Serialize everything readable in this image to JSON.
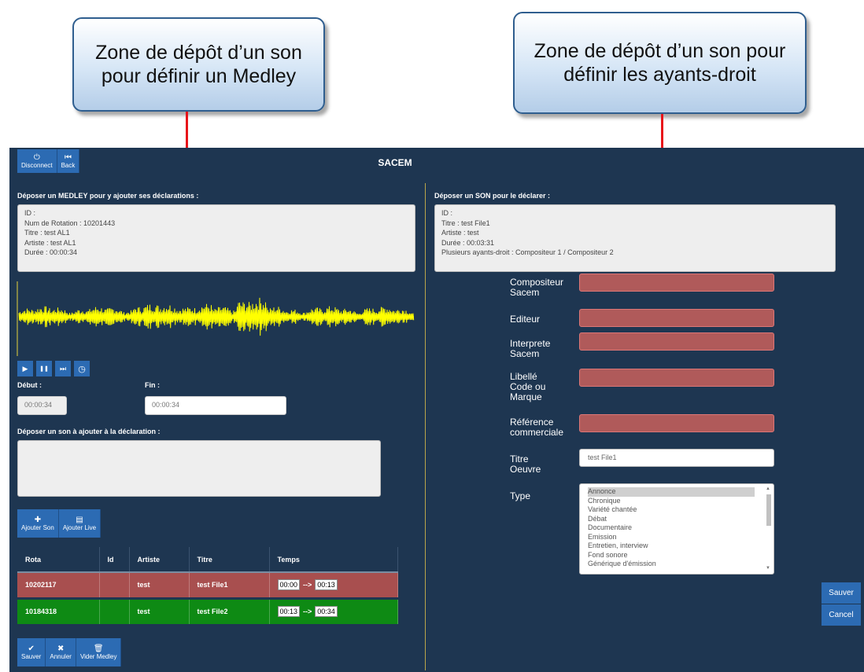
{
  "callouts": {
    "medley": "Zone de dépôt d’un son pour définir un Medley",
    "ayants": "Zone de dépôt d’un son pour définir les ayants-droit"
  },
  "app": {
    "title": "SACEM"
  },
  "toolbar": {
    "disconnect": {
      "icon": "power-icon",
      "glyph": "⏻",
      "label": "Disconnect"
    },
    "back": {
      "icon": "skip-back-icon",
      "glyph": "⏮",
      "label": "Back"
    }
  },
  "medley": {
    "section_label": "Déposer un MEDLEY pour y ajouter ses déclarations :",
    "info": [
      "ID :",
      "Num de Rotation : 10201443",
      "Titre : test AL1",
      "Artiste : test AL1",
      "Durée : 00:00:34"
    ]
  },
  "player": {
    "waveform_color": "#ffff00",
    "controls": [
      {
        "name": "play-icon",
        "glyph": "▶"
      },
      {
        "name": "pause-icon",
        "glyph": "❚❚"
      },
      {
        "name": "step-forward-icon",
        "glyph": "⏭"
      },
      {
        "name": "clock-icon",
        "glyph": "◷"
      }
    ],
    "debut_label": "Début :",
    "debut_value": "00:00:34",
    "fin_label": "Fin :",
    "fin_value": "00:00:34"
  },
  "ajout": {
    "label": "Déposer un son à ajouter à la déclaration :",
    "add_son": {
      "icon": "plus-icon",
      "glyph": "✚",
      "label": "Ajouter Son"
    },
    "add_live": {
      "icon": "list-icon",
      "glyph": "▤",
      "label": "Ajouter Live"
    }
  },
  "table": {
    "headers": [
      "Rota",
      "Id",
      "Artiste",
      "Titre",
      "Temps"
    ],
    "rows": [
      {
        "rota": "10202117",
        "id": "",
        "artiste": "test",
        "titre": "test File1",
        "start": "00:00",
        "arrow": "-->",
        "end": "00:13",
        "color": "#a84f4f"
      },
      {
        "rota": "10184318",
        "id": "",
        "artiste": "test",
        "titre": "test File2",
        "start": "00:13",
        "arrow": "-->",
        "end": "00:34",
        "color": "#0e8a14"
      }
    ]
  },
  "bottom_toolbar": {
    "sauver": {
      "icon": "check-icon",
      "glyph": "✔",
      "label": "Sauver"
    },
    "annuler": {
      "icon": "x-icon",
      "glyph": "✖",
      "label": "Annuler"
    },
    "vider": {
      "icon": "trash-icon",
      "glyph": "🗑",
      "label": "Vider Medley"
    }
  },
  "son": {
    "section_label": "Déposer un SON pour le déclarer :",
    "info": [
      "ID :",
      "Titre : test File1",
      "Artiste : test",
      "Durée : 00:03:31",
      "Plusieurs ayants-droit : Compositeur 1 / Compositeur 2"
    ]
  },
  "form": {
    "compositeur_label": "Compositeur\nSacem",
    "editeur_label": "Editeur",
    "interprete_label": "Interprete\nSacem",
    "libelle_label": "Libellé\nCode ou\nMarque",
    "reference_label": "Référence\ncommerciale",
    "titre_label": "Titre\nOeuvre",
    "titre_value": "test File1",
    "type_label": "Type",
    "required_color": "#b05a5a",
    "type_options": [
      "Annonce",
      "Chronique",
      "Variété chantée",
      "Débat",
      "Documentaire",
      "Emission",
      "Entretien, interview",
      "Fond sonore",
      "Générique d'émission"
    ],
    "type_selected": "Annonce"
  },
  "side": {
    "sauver": "Sauver",
    "cancel": "Cancel"
  }
}
